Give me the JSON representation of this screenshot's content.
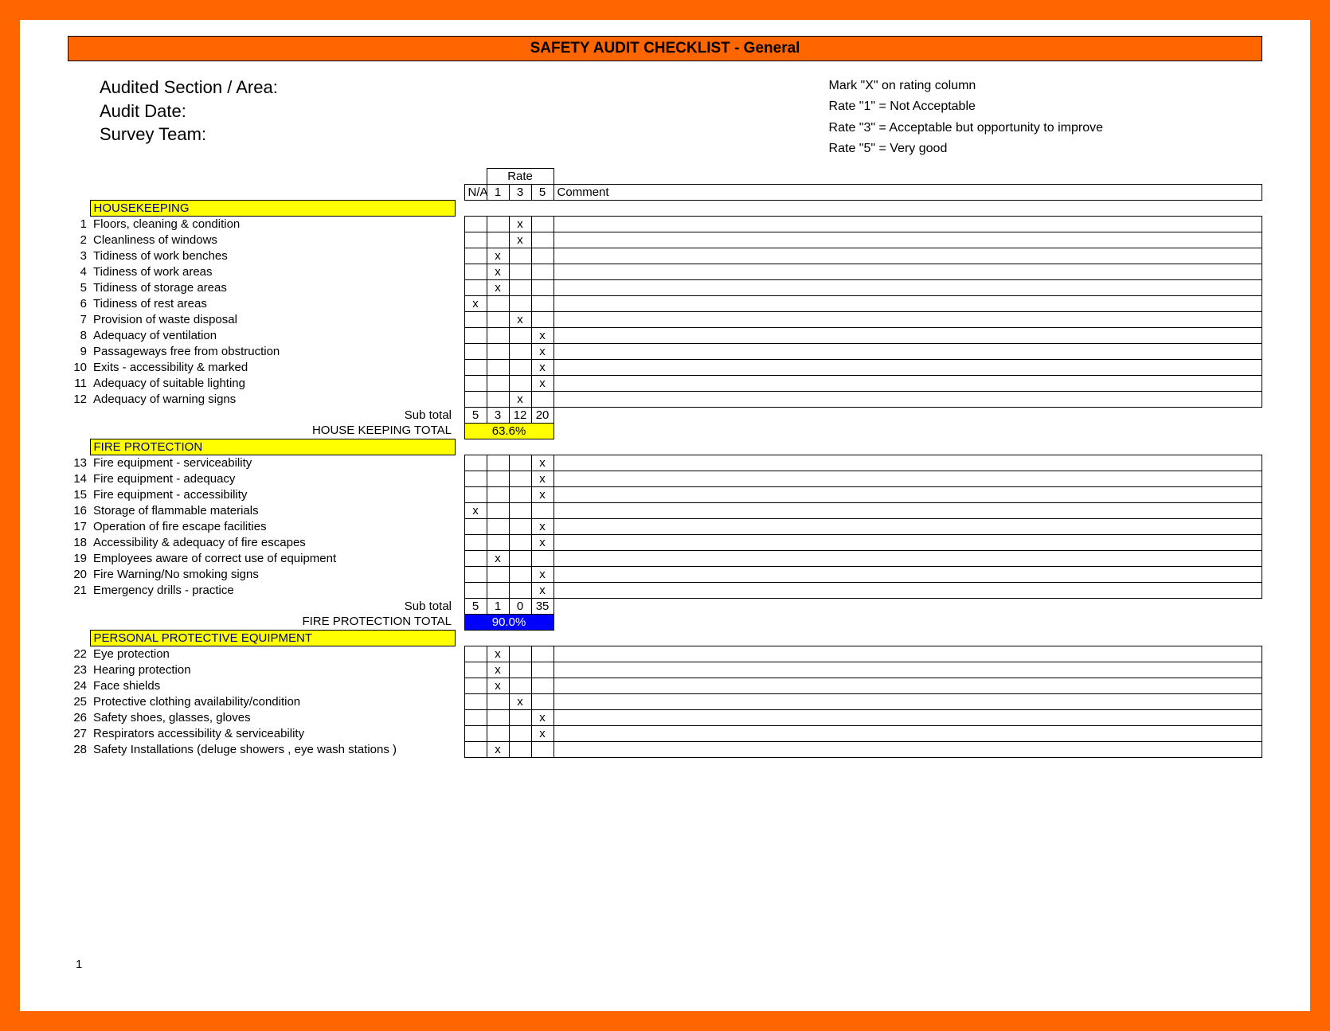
{
  "title": "SAFETY AUDIT CHECKLIST - General",
  "header_left": {
    "line1": "Audited Section / Area:",
    "line2": "Audit Date:",
    "line3": "Survey Team:"
  },
  "header_right": {
    "line1": "Mark \"X\" on rating column",
    "line2": "Rate \"1\" = Not Acceptable",
    "line3": "Rate \"3\" = Acceptable but opportunity to improve",
    "line4": "Rate \"5\" = Very good"
  },
  "col_headers": {
    "rate": "Rate",
    "na": "N/A",
    "r1": "1",
    "r3": "3",
    "r5": "5",
    "comment": "Comment"
  },
  "sections": {
    "housekeeping": {
      "title": "HOUSEKEEPING",
      "rows": [
        {
          "n": "1",
          "desc": "Floors, cleaning & condition",
          "col": "3"
        },
        {
          "n": "2",
          "desc": "Cleanliness of windows",
          "col": "3"
        },
        {
          "n": "3",
          "desc": "Tidiness of work benches",
          "col": "1"
        },
        {
          "n": "4",
          "desc": "Tidiness of work areas",
          "col": "1"
        },
        {
          "n": "5",
          "desc": "Tidiness of storage areas",
          "col": "1"
        },
        {
          "n": "6",
          "desc": "Tidiness of rest areas",
          "col": "na"
        },
        {
          "n": "7",
          "desc": "Provision of waste disposal",
          "col": "3"
        },
        {
          "n": "8",
          "desc": "Adequacy of ventilation",
          "col": "5"
        },
        {
          "n": "9",
          "desc": "Passageways free from obstruction",
          "col": "5"
        },
        {
          "n": "10",
          "desc": "Exits - accessibility & marked",
          "col": "5"
        },
        {
          "n": "11",
          "desc": "Adequacy of suitable lighting",
          "col": "5"
        },
        {
          "n": "12",
          "desc": "Adequacy of warning signs",
          "col": "3"
        }
      ],
      "subtotal_label": "Sub total",
      "subtotal": {
        "na": "5",
        "r1": "3",
        "r3": "12",
        "r5": "20"
      },
      "total_label": "HOUSE KEEPING TOTAL",
      "total_value": "63.6%",
      "total_style": "yellow"
    },
    "fire": {
      "title": "FIRE PROTECTION",
      "rows": [
        {
          "n": "13",
          "desc": "Fire equipment - serviceability",
          "col": "5"
        },
        {
          "n": "14",
          "desc": "Fire equipment - adequacy",
          "col": "5"
        },
        {
          "n": "15",
          "desc": "Fire equipment - accessibility",
          "col": "5"
        },
        {
          "n": "16",
          "desc": "Storage of flammable materials",
          "col": "na"
        },
        {
          "n": "17",
          "desc": "Operation of fire escape facilities",
          "col": "5"
        },
        {
          "n": "18",
          "desc": "Accessibility & adequacy of fire escapes",
          "col": "5"
        },
        {
          "n": "19",
          "desc": "Employees aware of correct use of equipment",
          "col": "1"
        },
        {
          "n": "20",
          "desc": "Fire Warning/No smoking signs",
          "col": "5"
        },
        {
          "n": "21",
          "desc": "Emergency drills - practice",
          "col": "5"
        }
      ],
      "subtotal_label": "Sub total",
      "subtotal": {
        "na": "5",
        "r1": "1",
        "r3": "0",
        "r5": "35"
      },
      "total_label": "FIRE PROTECTION TOTAL",
      "total_value": "90.0%",
      "total_style": "blue"
    },
    "ppe": {
      "title": "PERSONAL PROTECTIVE EQUIPMENT",
      "rows": [
        {
          "n": "22",
          "desc": "Eye protection",
          "col": "1"
        },
        {
          "n": "23",
          "desc": "Hearing protection",
          "col": "1"
        },
        {
          "n": "24",
          "desc": "Face shields",
          "col": "1"
        },
        {
          "n": "25",
          "desc": "Protective clothing availability/condition",
          "col": "3"
        },
        {
          "n": "26",
          "desc": "Safety shoes, glasses, gloves",
          "col": "5"
        },
        {
          "n": "27",
          "desc": "Respirators accessibility & serviceability",
          "col": "5"
        },
        {
          "n": "28",
          "desc": "Safety Installations (deluge showers , eye wash stations )",
          "col": "1"
        }
      ]
    }
  },
  "mark": "x",
  "page_num": "1"
}
